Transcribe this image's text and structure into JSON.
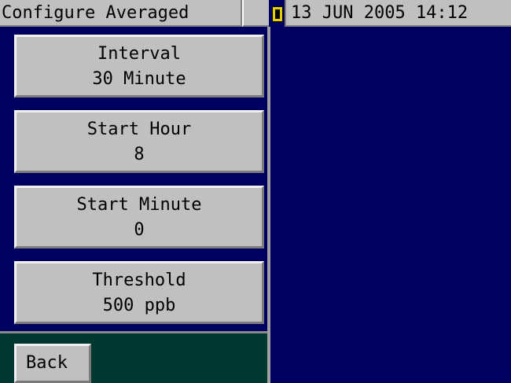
{
  "header": {
    "title": "Configure Averaged",
    "datetime": "13 JUN 2005 14:12",
    "status_indicator_color": "#e8d000"
  },
  "menu": {
    "items": [
      {
        "label": "Interval",
        "value": "30 Minute"
      },
      {
        "label": "Start Hour",
        "value": "8"
      },
      {
        "label": "Start Minute",
        "value": "0"
      },
      {
        "label": "Threshold",
        "value": "500 ppb"
      }
    ]
  },
  "footer": {
    "back_label": "Back"
  },
  "colors": {
    "background": "#000060",
    "button_face": "#c0c0c0",
    "footer_background": "#003830"
  }
}
